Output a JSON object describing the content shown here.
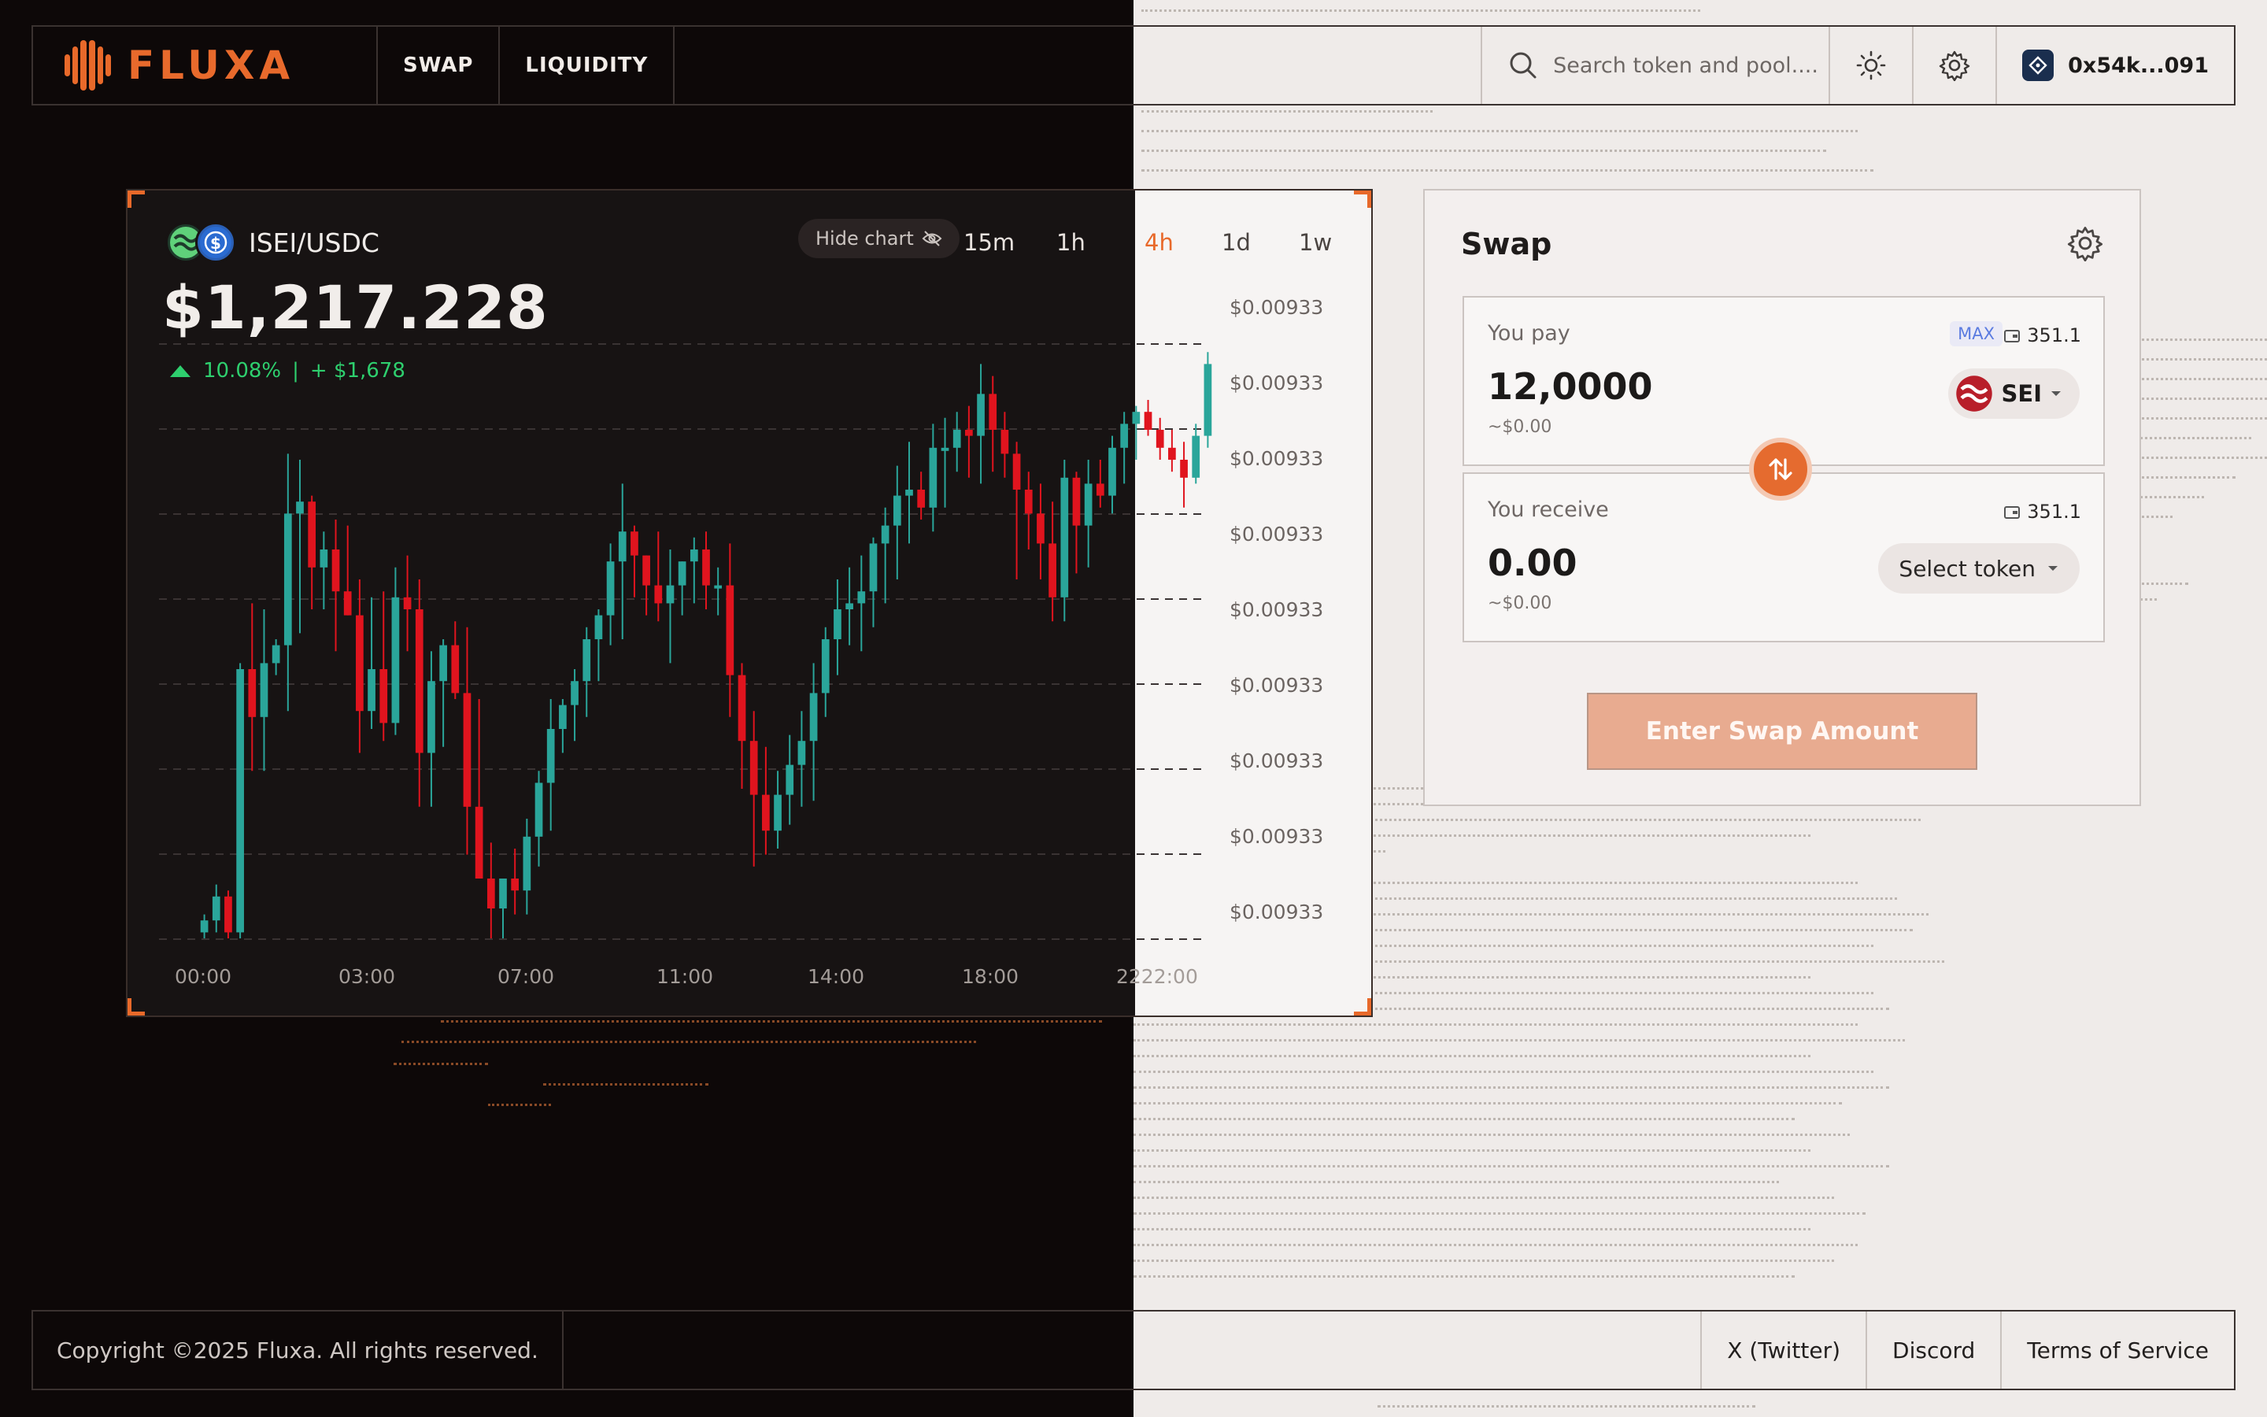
{
  "app": {
    "name": "FLUXA"
  },
  "nav": [
    {
      "label": "SWAP"
    },
    {
      "label": "LIQUIDITY"
    }
  ],
  "search": {
    "placeholder": "Search token and pool...."
  },
  "wallet": {
    "address": "0x54k...091"
  },
  "chart": {
    "pair": "ISEI/USDC",
    "price": "$1,217.228",
    "change_pct": "10.08%",
    "change_sep": "|",
    "change_abs": "+ $1,678",
    "hide_chart": "Hide chart",
    "timeframes": [
      "15m",
      "1h",
      "4h",
      "1d",
      "1w"
    ],
    "active_timeframe": "4h",
    "colors": {
      "up": "#2aa59a",
      "down": "#e0141e",
      "accent": "#e8692a"
    }
  },
  "chart_data": {
    "type": "candlestick",
    "title": "",
    "x_ticks": [
      "00:00",
      "03:00",
      "07:00",
      "11:00",
      "14:00",
      "18:00",
      "2222:00"
    ],
    "y_ticks": [
      "$0.00933",
      "$0.00933",
      "$0.00933",
      "$0.00933",
      "$0.00933",
      "$0.00933",
      "$0.00933",
      "$0.00933",
      "$0.00933"
    ],
    "ylim": [
      0,
      100
    ],
    "grid": true,
    "candles": [
      {
        "o": 1,
        "h": 4,
        "l": 0,
        "c": 3
      },
      {
        "o": 3,
        "h": 9,
        "l": 1,
        "c": 7
      },
      {
        "o": 7,
        "h": 8,
        "l": 0,
        "c": 1
      },
      {
        "o": 1,
        "h": 46,
        "l": 0,
        "c": 45
      },
      {
        "o": 45,
        "h": 56,
        "l": 28,
        "c": 37
      },
      {
        "o": 37,
        "h": 55,
        "l": 28,
        "c": 46
      },
      {
        "o": 46,
        "h": 50,
        "l": 44,
        "c": 49
      },
      {
        "o": 49,
        "h": 81,
        "l": 38,
        "c": 71
      },
      {
        "o": 71,
        "h": 80,
        "l": 51,
        "c": 73
      },
      {
        "o": 73,
        "h": 74,
        "l": 55,
        "c": 62
      },
      {
        "o": 62,
        "h": 68,
        "l": 55,
        "c": 65
      },
      {
        "o": 65,
        "h": 70,
        "l": 48,
        "c": 58
      },
      {
        "o": 58,
        "h": 69,
        "l": 55,
        "c": 54
      },
      {
        "o": 54,
        "h": 60,
        "l": 31,
        "c": 38
      },
      {
        "o": 38,
        "h": 57,
        "l": 35,
        "c": 45
      },
      {
        "o": 45,
        "h": 58,
        "l": 33,
        "c": 36
      },
      {
        "o": 36,
        "h": 62,
        "l": 34,
        "c": 57
      },
      {
        "o": 57,
        "h": 64,
        "l": 48,
        "c": 55
      },
      {
        "o": 55,
        "h": 60,
        "l": 22,
        "c": 31
      },
      {
        "o": 31,
        "h": 48,
        "l": 22,
        "c": 43
      },
      {
        "o": 43,
        "h": 50,
        "l": 32,
        "c": 49
      },
      {
        "o": 49,
        "h": 53,
        "l": 40,
        "c": 41
      },
      {
        "o": 41,
        "h": 52,
        "l": 14,
        "c": 22
      },
      {
        "o": 22,
        "h": 40,
        "l": 11,
        "c": 10
      },
      {
        "o": 10,
        "h": 16,
        "l": 0,
        "c": 5
      },
      {
        "o": 5,
        "h": 10,
        "l": 0,
        "c": 10
      },
      {
        "o": 10,
        "h": 15,
        "l": 4,
        "c": 8
      },
      {
        "o": 8,
        "h": 20,
        "l": 4,
        "c": 17
      },
      {
        "o": 17,
        "h": 28,
        "l": 12,
        "c": 26
      },
      {
        "o": 26,
        "h": 40,
        "l": 18,
        "c": 35
      },
      {
        "o": 35,
        "h": 40,
        "l": 31,
        "c": 39
      },
      {
        "o": 39,
        "h": 45,
        "l": 33,
        "c": 43
      },
      {
        "o": 43,
        "h": 52,
        "l": 37,
        "c": 50
      },
      {
        "o": 50,
        "h": 55,
        "l": 43,
        "c": 54
      },
      {
        "o": 54,
        "h": 66,
        "l": 49,
        "c": 63
      },
      {
        "o": 63,
        "h": 76,
        "l": 50,
        "c": 68
      },
      {
        "o": 68,
        "h": 69,
        "l": 57,
        "c": 64
      },
      {
        "o": 64,
        "h": 62,
        "l": 54,
        "c": 59
      },
      {
        "o": 59,
        "h": 68,
        "l": 53,
        "c": 56
      },
      {
        "o": 56,
        "h": 65,
        "l": 46,
        "c": 59
      },
      {
        "o": 59,
        "h": 62,
        "l": 54,
        "c": 63
      },
      {
        "o": 63,
        "h": 67,
        "l": 56,
        "c": 65
      },
      {
        "o": 65,
        "h": 68,
        "l": 55,
        "c": 59
      },
      {
        "o": 59,
        "h": 62,
        "l": 54,
        "c": 59
      },
      {
        "o": 59,
        "h": 66,
        "l": 37,
        "c": 44
      },
      {
        "o": 44,
        "h": 46,
        "l": 25,
        "c": 33
      },
      {
        "o": 33,
        "h": 38,
        "l": 12,
        "c": 24
      },
      {
        "o": 24,
        "h": 32,
        "l": 14,
        "c": 18
      },
      {
        "o": 18,
        "h": 28,
        "l": 15,
        "c": 24
      },
      {
        "o": 24,
        "h": 34,
        "l": 19,
        "c": 29
      },
      {
        "o": 29,
        "h": 38,
        "l": 22,
        "c": 33
      },
      {
        "o": 33,
        "h": 46,
        "l": 23,
        "c": 41
      },
      {
        "o": 41,
        "h": 52,
        "l": 37,
        "c": 50
      },
      {
        "o": 50,
        "h": 60,
        "l": 44,
        "c": 55
      },
      {
        "o": 55,
        "h": 62,
        "l": 49,
        "c": 56
      },
      {
        "o": 56,
        "h": 64,
        "l": 48,
        "c": 58
      },
      {
        "o": 58,
        "h": 67,
        "l": 52,
        "c": 66
      },
      {
        "o": 66,
        "h": 72,
        "l": 56,
        "c": 69
      },
      {
        "o": 69,
        "h": 79,
        "l": 60,
        "c": 74
      },
      {
        "o": 74,
        "h": 83,
        "l": 66,
        "c": 75
      },
      {
        "o": 75,
        "h": 78,
        "l": 70,
        "c": 72
      },
      {
        "o": 72,
        "h": 86,
        "l": 68,
        "c": 82
      },
      {
        "o": 82,
        "h": 87,
        "l": 72,
        "c": 82
      },
      {
        "o": 82,
        "h": 88,
        "l": 78,
        "c": 85
      },
      {
        "o": 85,
        "h": 89,
        "l": 77,
        "c": 84
      },
      {
        "o": 84,
        "h": 96,
        "l": 76,
        "c": 91
      },
      {
        "o": 91,
        "h": 94,
        "l": 78,
        "c": 85
      },
      {
        "o": 85,
        "h": 88,
        "l": 77,
        "c": 81
      },
      {
        "o": 81,
        "h": 83,
        "l": 60,
        "c": 75
      },
      {
        "o": 75,
        "h": 78,
        "l": 65,
        "c": 71
      },
      {
        "o": 71,
        "h": 76,
        "l": 60,
        "c": 66
      },
      {
        "o": 66,
        "h": 73,
        "l": 53,
        "c": 57
      },
      {
        "o": 57,
        "h": 80,
        "l": 53,
        "c": 77
      },
      {
        "o": 77,
        "h": 78,
        "l": 61,
        "c": 69
      },
      {
        "o": 69,
        "h": 80,
        "l": 62,
        "c": 76
      },
      {
        "o": 76,
        "h": 80,
        "l": 72,
        "c": 74
      },
      {
        "o": 74,
        "h": 84,
        "l": 71,
        "c": 82
      },
      {
        "o": 82,
        "h": 88,
        "l": 76,
        "c": 86
      },
      {
        "o": 86,
        "h": 89,
        "l": 80,
        "c": 88
      },
      {
        "o": 88,
        "h": 90,
        "l": 84,
        "c": 85
      },
      {
        "o": 85,
        "h": 87,
        "l": 80,
        "c": 82
      },
      {
        "o": 82,
        "h": 85,
        "l": 78,
        "c": 80
      },
      {
        "o": 80,
        "h": 83,
        "l": 72,
        "c": 77
      },
      {
        "o": 77,
        "h": 86,
        "l": 76,
        "c": 84
      },
      {
        "o": 84,
        "h": 98,
        "l": 82,
        "c": 96
      }
    ]
  },
  "swap": {
    "title": "Swap",
    "pay": {
      "label": "You pay",
      "max": "MAX",
      "balance": "351.1",
      "amount": "12,0000",
      "usd": "~$0.00",
      "token": "SEI"
    },
    "receive": {
      "label": "You receive",
      "balance": "351.1",
      "amount": "0.00",
      "usd": "~$0.00",
      "select": "Select token"
    },
    "cta": "Enter Swap Amount"
  },
  "footer": {
    "copyright": "Copyright ©2025 Fluxa. All rights reserved.",
    "links": [
      "X (Twitter)",
      "Discord",
      "Terms of Service"
    ]
  }
}
